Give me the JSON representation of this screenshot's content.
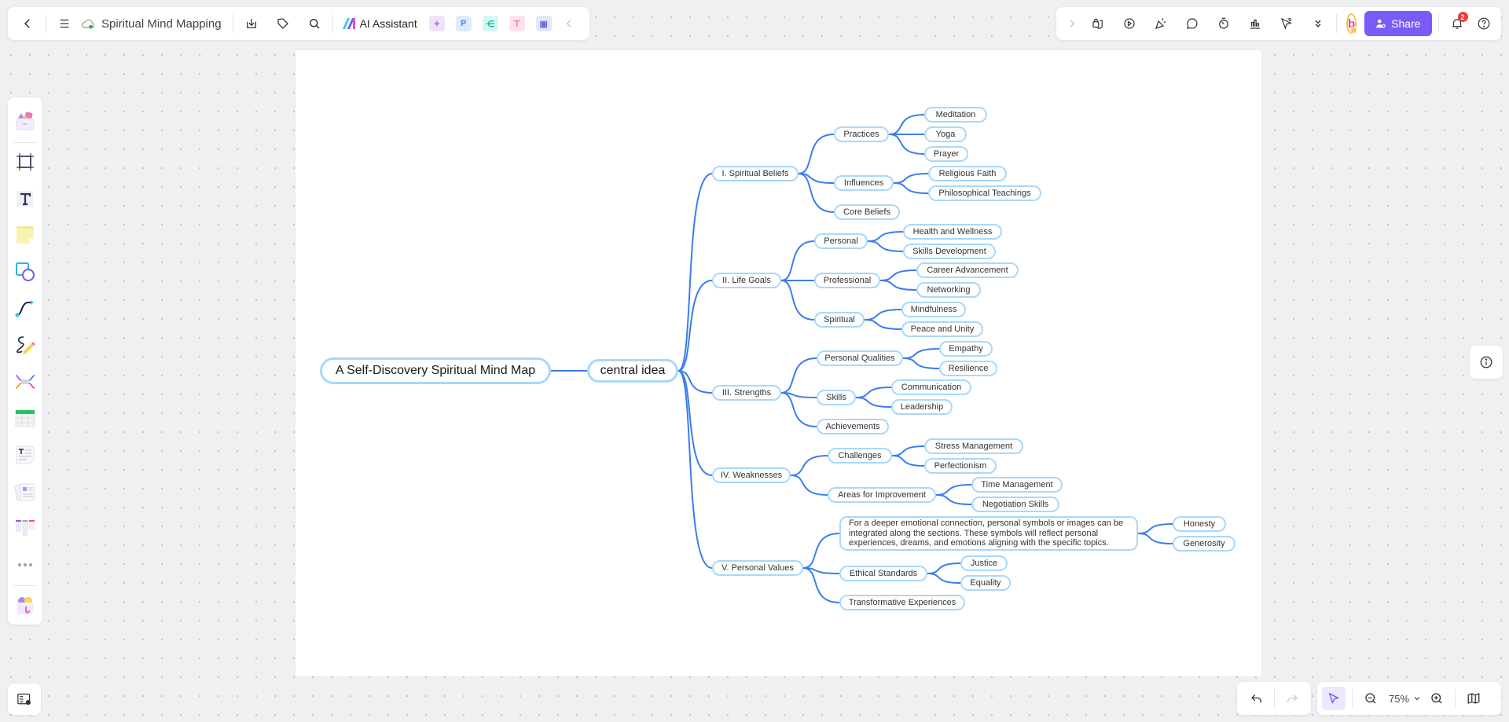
{
  "topbar": {
    "back_icon": "chevron-left-icon",
    "menu_icon": "hamburger-menu-icon",
    "cloud_icon": "cloud-synced-icon",
    "doc_title": "Spiritual Mind Mapping",
    "download_icon": "download-icon",
    "tag_icon": "tag-icon",
    "search_icon": "search-icon",
    "ai_assistant_label": "AI Assistant",
    "app_icons": [
      {
        "name": "ai-image-icon",
        "glyph": "✦",
        "bg": "#efe3fb",
        "color": "#b37fea"
      },
      {
        "name": "presentation-p-icon",
        "glyph": "P",
        "bg": "#dcecfd",
        "color": "#2f8ef0"
      },
      {
        "name": "mindmap-app-icon",
        "glyph": "⋲",
        "bg": "#d8f6f3",
        "color": "#10b8a8"
      },
      {
        "name": "flowchart-app-icon",
        "glyph": "⊤",
        "bg": "#fde2ec",
        "color": "#ef5c9a"
      },
      {
        "name": "chat-app-icon",
        "glyph": "▣",
        "bg": "#e6e6fb",
        "color": "#6a6ae8"
      }
    ],
    "collapse_icon": "chevron-left-icon",
    "right": {
      "expand_icon": "chevron-right-icon",
      "tools": [
        "lock-sticky-icon",
        "play-presentation-icon",
        "celebrate-icon",
        "comment-icon",
        "timer-icon",
        "chart-icon",
        "laser-pointer-icon",
        "more-chevrons-icon"
      ],
      "avatar_letter": "b",
      "share_label": "Share",
      "notification_count": "2",
      "help_icon": "help-icon"
    }
  },
  "left_toolbar": [
    "templates-icon",
    "frame-icon",
    "text-icon",
    "sticky-note-icon",
    "shapes-icon",
    "connector-icon",
    "pen-icon",
    "mindmap-icon",
    "table-icon",
    "document-icon",
    "cards-icon",
    "kanban-icon",
    "more-icon",
    "app-box-icon"
  ],
  "mindmap": {
    "root": "A Self-Discovery Spiritual Mind Map",
    "center": "central idea",
    "branches": [
      {
        "label": "I. Spiritual Beliefs",
        "children": [
          {
            "label": "Practices",
            "children": [
              "Meditation",
              "Yoga",
              "Prayer"
            ]
          },
          {
            "label": "Influences",
            "children": [
              "Religious Faith",
              "Philosophical Teachings"
            ]
          },
          {
            "label": "Core Beliefs",
            "children": []
          }
        ]
      },
      {
        "label": "II. Life Goals",
        "children": [
          {
            "label": "Personal",
            "children": [
              "Health and Wellness",
              "Skills Development"
            ]
          },
          {
            "label": "Professional",
            "children": [
              "Career Advancement",
              "Networking"
            ]
          },
          {
            "label": "Spiritual",
            "children": [
              "Mindfulness",
              "Peace and Unity"
            ]
          }
        ]
      },
      {
        "label": "III. Strengths",
        "children": [
          {
            "label": "Personal Qualities",
            "children": [
              "Empathy",
              "Resilience"
            ]
          },
          {
            "label": "Skills",
            "children": [
              "Communication",
              "Leadership"
            ]
          },
          {
            "label": "Achievements",
            "children": []
          }
        ]
      },
      {
        "label": "IV. Weaknesses",
        "children": [
          {
            "label": "Challenges",
            "children": [
              "Stress Management",
              "Perfectionism"
            ]
          },
          {
            "label": "Areas for Improvement",
            "children": [
              "Time Management",
              "Negotiation Skills"
            ]
          }
        ]
      },
      {
        "label": "V. Personal Values",
        "children": [
          {
            "label": "For a deeper emotional connection, personal symbols or images can be integrated along the sections. These symbols will reflect personal experiences, dreams, and emotions aligning with the specific topics.",
            "children": [
              "Honesty",
              "Generosity"
            ]
          },
          {
            "label": "Ethical Standards",
            "children": [
              "Justice",
              "Equality"
            ]
          },
          {
            "label": "Transformative Experiences",
            "children": []
          }
        ]
      }
    ]
  },
  "colors": {
    "connector": "#3b7cf0",
    "node_border": "#a8d8fc",
    "accent": "#7a5af8"
  },
  "bottom": {
    "undo_icon": "undo-icon",
    "redo_icon": "redo-icon",
    "select_icon": "select-pointer-icon",
    "zoom_out_icon": "zoom-out-icon",
    "zoom_level": "75%",
    "zoom_in_icon": "zoom-in-icon",
    "map_icon": "minimap-icon",
    "outline_icon": "outline-view-icon",
    "info_icon": "info-icon"
  }
}
